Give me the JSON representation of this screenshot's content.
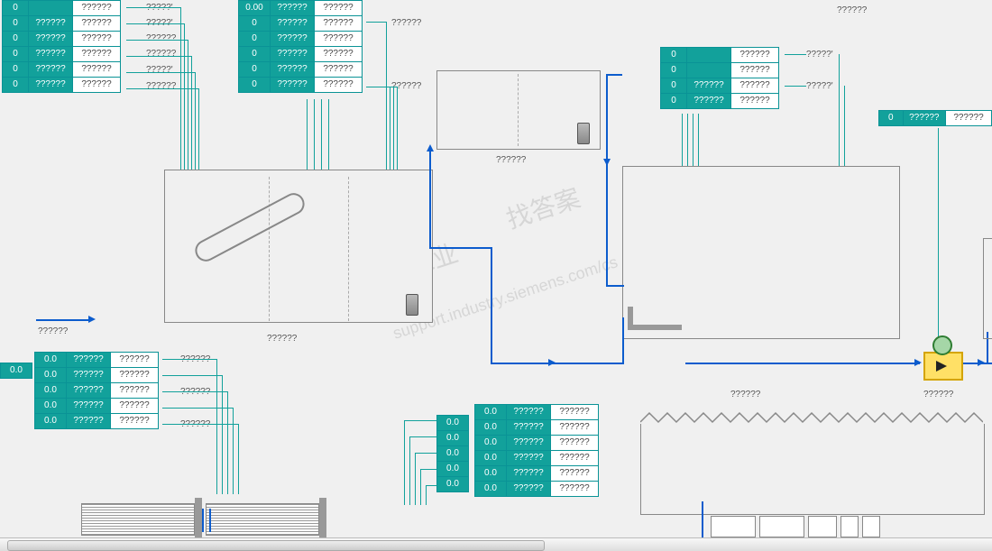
{
  "watermarks": {
    "a": "西门子工业",
    "b": "找答案",
    "c": "support.industry.siemens.com/cs"
  },
  "top_left": {
    "rows": [
      {
        "v": "0",
        "t": "",
        "u": "??????"
      },
      {
        "v": "0",
        "t": "??????",
        "u": "??????"
      },
      {
        "v": "0",
        "t": "??????",
        "u": "??????"
      },
      {
        "v": "0",
        "t": "??????",
        "u": "??????"
      },
      {
        "v": "0",
        "t": "??????",
        "u": "??????"
      },
      {
        "v": "0",
        "t": "??????",
        "u": "??????"
      }
    ],
    "ext": [
      "?????'",
      "?????'",
      "??????",
      "??????",
      "?????'",
      "??????"
    ]
  },
  "top_mid": {
    "rows": [
      {
        "v": "0.00",
        "t": "??????",
        "u": "??????"
      },
      {
        "v": "0",
        "t": "??????",
        "u": "??????"
      },
      {
        "v": "0",
        "t": "??????",
        "u": "??????"
      },
      {
        "v": "0",
        "t": "??????",
        "u": "??????"
      },
      {
        "v": "0",
        "t": "??????",
        "u": "??????"
      },
      {
        "v": "0",
        "t": "??????",
        "u": "??????"
      }
    ],
    "ext": [
      "",
      "??????",
      "",
      "",
      "",
      "??????"
    ]
  },
  "top_right_lbl": "??????",
  "right_tbl": {
    "rows": [
      {
        "v": "0",
        "t": "",
        "u": "??????"
      },
      {
        "v": "0",
        "t": "",
        "u": "??????"
      },
      {
        "v": "0",
        "t": "??????",
        "u": "??????"
      },
      {
        "v": "0",
        "t": "??????",
        "u": "??????"
      }
    ],
    "ext": [
      "?????'",
      "",
      "?????'",
      ""
    ]
  },
  "far_right": {
    "v": "0",
    "t": "??????",
    "u": "??????"
  },
  "inflow_arrow": "??????",
  "big_tank_lbl": "??????",
  "small_tank_lbl": "??????",
  "right_tank_lbl": "??????",
  "valve_lbl": "??????",
  "left_side_cell": {
    "v": "0.0",
    "t": "",
    "u": ""
  },
  "left_stack": {
    "rows": [
      {
        "v": "0.0",
        "t": "??????",
        "u": "??????"
      },
      {
        "v": "0.0",
        "t": "??????",
        "u": "??????"
      },
      {
        "v": "0.0",
        "t": "??????",
        "u": "??????"
      },
      {
        "v": "0.0",
        "t": "??????",
        "u": "??????"
      },
      {
        "v": "0.0",
        "t": "??????",
        "u": "??????"
      }
    ],
    "ext": [
      "??????",
      "",
      "??????",
      "",
      "??????"
    ]
  },
  "mid_left_col": [
    {
      "v": "0.0"
    },
    {
      "v": "0.0"
    },
    {
      "v": "0.0"
    },
    {
      "v": "0.0"
    },
    {
      "v": "0.0"
    }
  ],
  "mid_right": [
    {
      "v": "0.0",
      "t": "??????",
      "u": "??????"
    },
    {
      "v": "0.0",
      "t": "??????",
      "u": "??????"
    },
    {
      "v": "0.0",
      "t": "??????",
      "u": "??????"
    },
    {
      "v": "0.0",
      "t": "??????",
      "u": "??????"
    },
    {
      "v": "0.0",
      "t": "??????",
      "u": "??????"
    },
    {
      "v": "0.0",
      "t": "??????",
      "u": "??????"
    }
  ]
}
